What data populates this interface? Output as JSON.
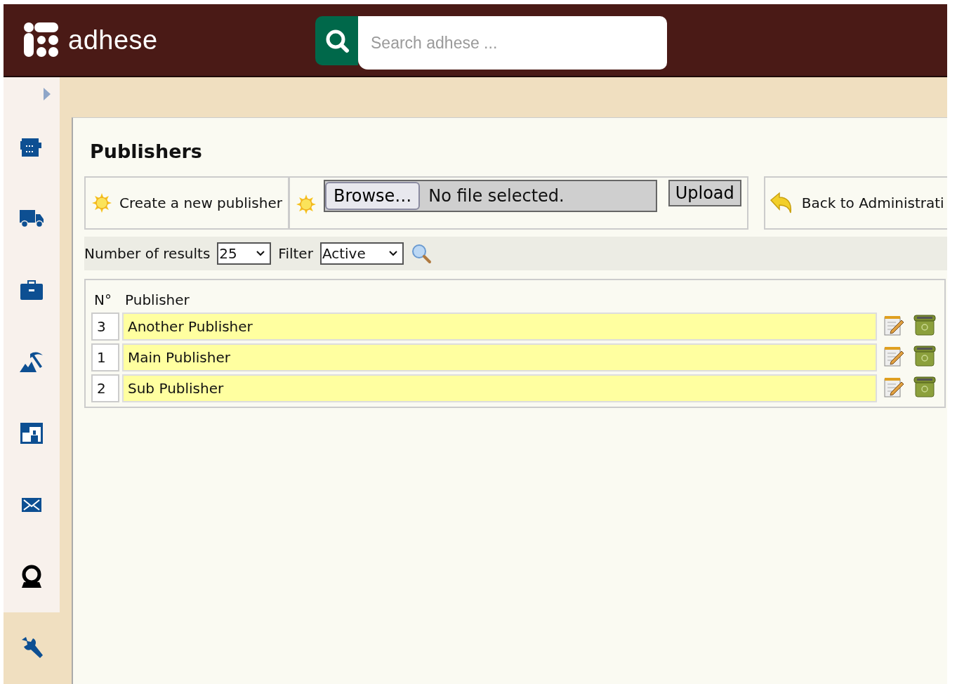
{
  "header": {
    "logo": "adhese",
    "search": {
      "placeholder": "Search adhese ..."
    }
  },
  "sidebar": {
    "items": [
      {
        "kind": "inventory",
        "selected": false
      },
      {
        "kind": "truck",
        "selected": false
      },
      {
        "kind": "briefcase",
        "selected": false
      },
      {
        "kind": "mining",
        "selected": false
      },
      {
        "kind": "screen",
        "selected": false
      },
      {
        "kind": "mail",
        "selected": false
      },
      {
        "kind": "webcam",
        "selected": false
      },
      {
        "kind": "wrench",
        "selected": true
      }
    ]
  },
  "page": {
    "title": "Publishers",
    "actions": {
      "create": "Create a new publisher",
      "browse": "Browse…",
      "file_status": "No file selected.",
      "upload": "Upload",
      "back": "Back to Administrati"
    },
    "filters": {
      "results_label": "Number of results",
      "results_value": "25",
      "filter_label": "Filter",
      "filter_value": "Active"
    },
    "table": {
      "columns": [
        "N°",
        "Publisher"
      ],
      "rows": [
        {
          "number": "3",
          "name": "Another Publisher"
        },
        {
          "number": "1",
          "name": "Main Publisher"
        },
        {
          "number": "2",
          "name": "Sub Publisher"
        }
      ]
    }
  }
}
